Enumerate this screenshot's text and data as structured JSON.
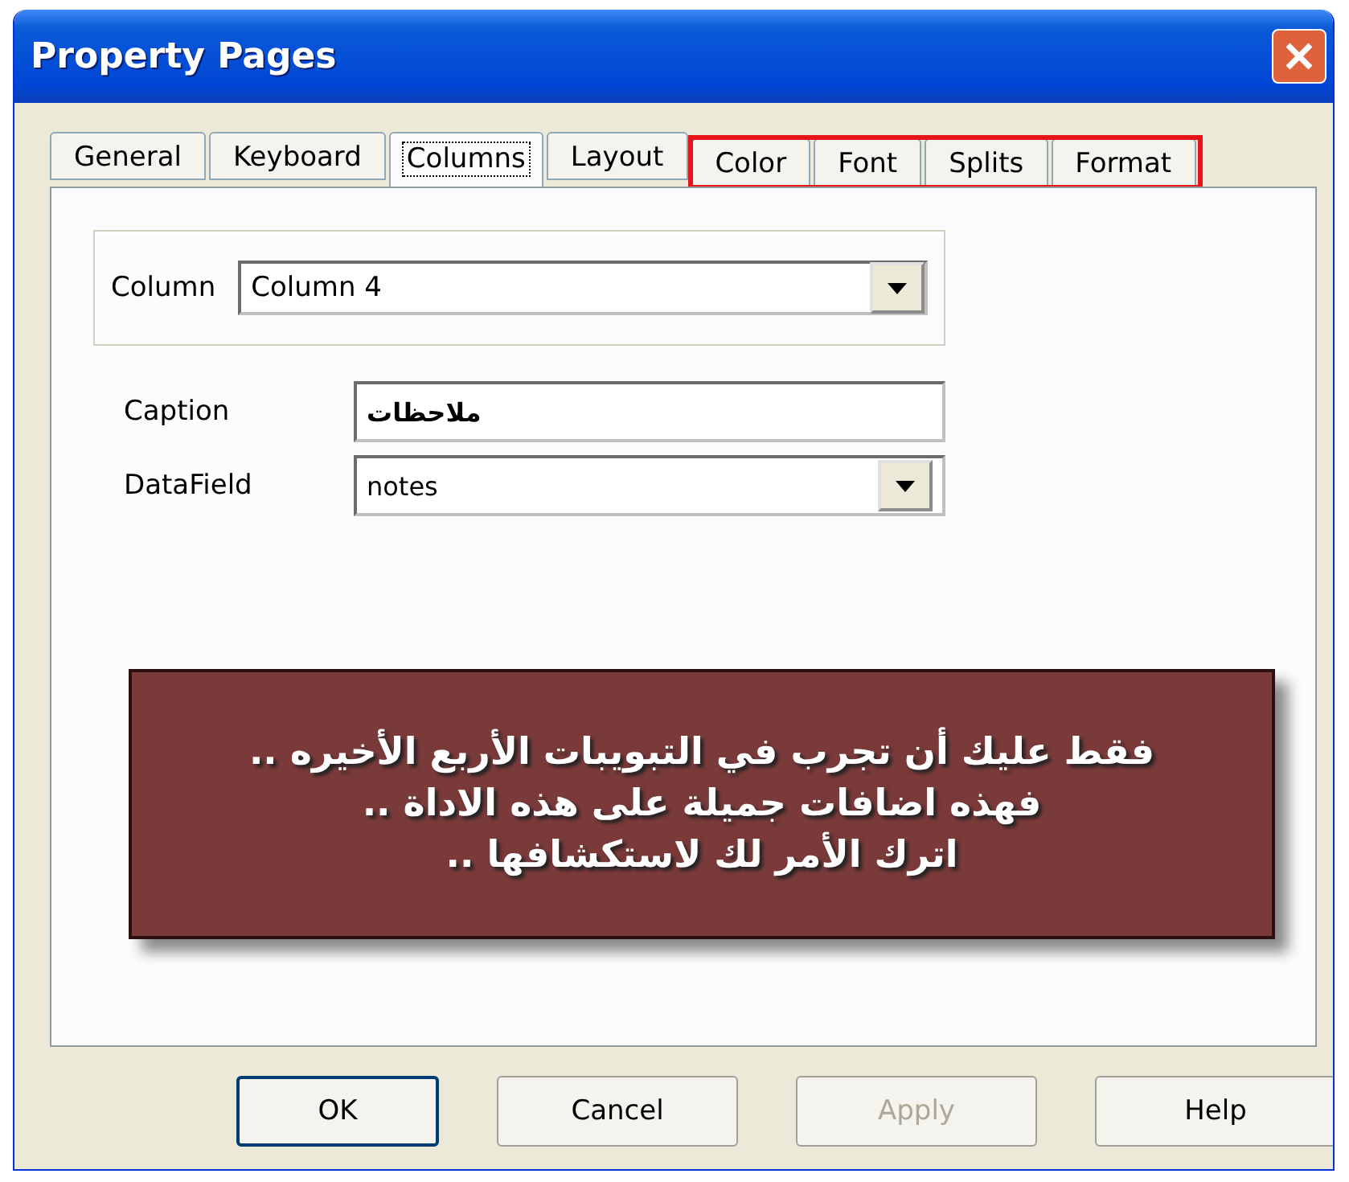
{
  "window": {
    "title": "Property Pages"
  },
  "tabs": [
    {
      "label": "General",
      "selected": false,
      "highlighted": false
    },
    {
      "label": "Keyboard",
      "selected": false,
      "highlighted": false
    },
    {
      "label": "Columns",
      "selected": true,
      "highlighted": false
    },
    {
      "label": "Layout",
      "selected": false,
      "highlighted": false
    },
    {
      "label": "Color",
      "selected": false,
      "highlighted": true
    },
    {
      "label": "Font",
      "selected": false,
      "highlighted": true
    },
    {
      "label": "Splits",
      "selected": false,
      "highlighted": true
    },
    {
      "label": "Format",
      "selected": false,
      "highlighted": true
    }
  ],
  "column_group": {
    "label": "Column",
    "value": "Column 4"
  },
  "fields": [
    {
      "kind": "text",
      "label": "Caption",
      "value": "ملاحظات"
    },
    {
      "kind": "dropdown",
      "label": "DataField",
      "value": "notes"
    }
  ],
  "callout": {
    "lines": [
      "فقط عليك أن تجرب في التبويبات الأربع الأخيره ..",
      "فهذه اضافات جميلة على هذه الاداة ..",
      "اترك الأمر لك لاستكشافها .."
    ]
  },
  "buttons": [
    {
      "label": "OK",
      "default": true,
      "disabled": false
    },
    {
      "label": "Cancel",
      "default": false,
      "disabled": false
    },
    {
      "label": "Apply",
      "default": false,
      "disabled": true
    },
    {
      "label": "Help",
      "default": false,
      "disabled": false
    }
  ]
}
